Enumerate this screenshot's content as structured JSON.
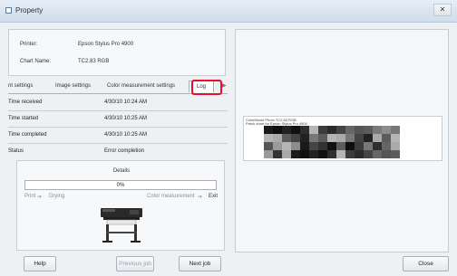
{
  "window": {
    "title": "Property",
    "close_glyph": "✕"
  },
  "info": {
    "printer_label": "Printer:",
    "printer_value": "Epson Stylus Pro 4900",
    "chart_label": "Chart Name:",
    "chart_value": "TC2.83 RGB"
  },
  "tabs": [
    {
      "label": "nt settings"
    },
    {
      "label": "Image settings"
    },
    {
      "label": "Color measurement settings"
    },
    {
      "label": "Log"
    }
  ],
  "log": [
    {
      "key": "Time received",
      "value": "4/30/10 10:24 AM"
    },
    {
      "key": "Time started",
      "value": "4/30/10 10:25 AM"
    },
    {
      "key": "Time completed",
      "value": "4/30/10 10:25 AM"
    },
    {
      "key": "Status",
      "value": "Error completion"
    }
  ],
  "details": {
    "title": "Details",
    "progress_text": "0%",
    "progress_fraction": 0,
    "step_print": "Print",
    "step_drying": "Drying",
    "step_measure": "Color measurement",
    "step_exit": "Exit"
  },
  "buttons": {
    "help": "Help",
    "previous": "Previous job",
    "next": "Next job",
    "close": "Close"
  },
  "preview_header": [
    "ColorMunki Photo TC2.83 RGB",
    "Patch chart for Epson Stylus Pro 4900"
  ],
  "colors": {
    "highlight": "#e3112a",
    "accent_arrow": "#7aa0d0"
  }
}
